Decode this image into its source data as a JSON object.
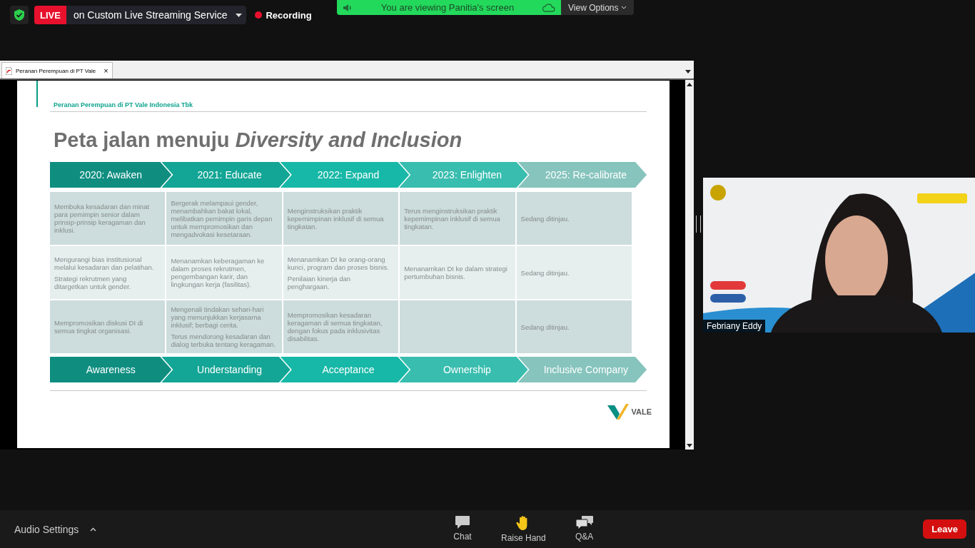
{
  "top_bar": {
    "live_badge": "LIVE",
    "stream_target": "on Custom Live Streaming Service",
    "recording": "Recording",
    "banner": "You are viewing Panitia's screen",
    "view_options": "View Options"
  },
  "share_window": {
    "tab": {
      "title": "Peranan Perempuan di PT Vale",
      "selected": true,
      "close": "×"
    },
    "slide": {
      "header": "Peranan Perempuan di PT Vale Indonesia Tbk",
      "title": "Peta jalan menuju *Diversity and Inclusion*",
      "stages": [
        "2020: Awaken",
        "2021: Educate",
        "2022: Expand",
        "2023: Enlighten",
        "2025: Re-calibrate"
      ],
      "rows": [
        {
          "cells": [
            {
              "lines": [
                "Membuka kesadaran dan minat para pemimpin senior dalam prinsip-prinsip keragaman dan inklusi."
              ]
            },
            {
              "lines": [
                "Bergerak melampaui gender, menambahkan bakat lokal, melibatkan pemimpin garis depan untuk mempromosikan dan mengadvokasi kesetaraan."
              ]
            },
            {
              "lines": [
                "Menginstruksikan praktik kepemimpinan inklusif di semua tingkatan."
              ]
            },
            {
              "lines": [
                "Terus menginstruksikan praktik kepemimpinan inklusif di semua tingkatan."
              ]
            },
            {
              "lines": [
                "Sedang ditinjau."
              ]
            }
          ]
        },
        {
          "cells": [
            {
              "lines": [
                "Mengurangi bias institusional melalui kesadaran dan pelatihan.",
                "Strategi rekrutmen yang ditargetkan untuk gender."
              ]
            },
            {
              "lines": [
                "Menanamkan keberagaman ke dalam proses rekrutmen, pengembangan karir, dan lingkungan kerja (fasilitas)."
              ]
            },
            {
              "lines": [
                "Menanamkan DI ke orang-orang kunci, program dan proses bisnis.",
                "Penilaian kinerja dan penghargaan."
              ]
            },
            {
              "lines": [
                "Menanamkan DI ke dalam strategi pertumbuhan bisnis."
              ]
            },
            {
              "lines": [
                "Sedang ditinjau."
              ]
            }
          ]
        },
        {
          "cells": [
            {
              "lines": [
                "Mempromosikan diskusi DI di semua tingkat organisasi."
              ]
            },
            {
              "lines": [
                "Mengenali tindakan sehari-hari yang menunjukkan kerjasama inklusif; berbagi cerita.",
                "Terus mendorong kesadaran dan dialog terbuka tentang keragaman."
              ]
            },
            {
              "lines": [
                "Mempromosikan kesadaran keragaman di semua tingkatan, dengan fokus pada inklusivitas disabilitas."
              ]
            },
            {},
            {
              "lines": [
                "Sedang ditinjau."
              ]
            }
          ]
        }
      ],
      "phases": [
        "Awareness",
        "Understanding",
        "Acceptance",
        "Ownership",
        "Inclusive Company"
      ],
      "logo_text": "VALE"
    }
  },
  "video_tile": {
    "kind": "picture",
    "name": "Febriany Eddy"
  },
  "toolbar": {
    "audio_settings": "Audio Settings",
    "buttons": [
      {
        "kind": "chat",
        "label": "Chat"
      },
      {
        "kind": "hand",
        "label": "Raise Hand"
      },
      {
        "kind": "qa",
        "label": "Q&A"
      }
    ],
    "leave": "Leave"
  }
}
